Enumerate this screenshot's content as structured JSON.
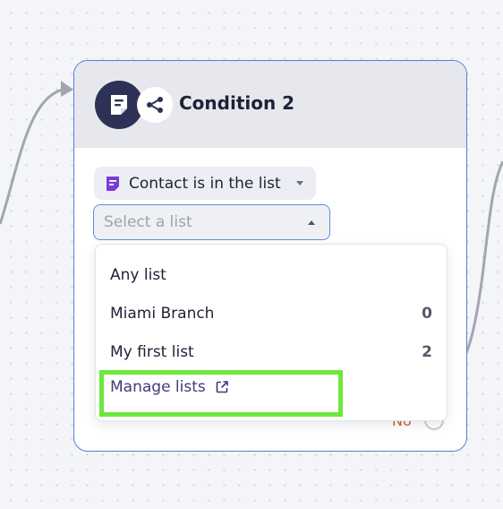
{
  "node": {
    "title": "Condition 2",
    "icon": "note-icon",
    "badge_icon": "share-icon",
    "border_color": "#4d80dd"
  },
  "condition": {
    "label": "Contact is in the list",
    "icon": "note-icon",
    "icon_color": "#7a3bd6"
  },
  "list_select": {
    "placeholder": "Select a list"
  },
  "branch": {
    "no_label": "No",
    "no_color": "#e0542f"
  },
  "dropdown": {
    "items": [
      {
        "label": "Any list",
        "count": ""
      },
      {
        "label": "Miami Branch",
        "count": "0"
      },
      {
        "label": "My first list",
        "count": "2"
      }
    ],
    "manage_label": "Manage lists",
    "manage_icon": "external-link-icon"
  },
  "highlight_color": "#6ce73c"
}
